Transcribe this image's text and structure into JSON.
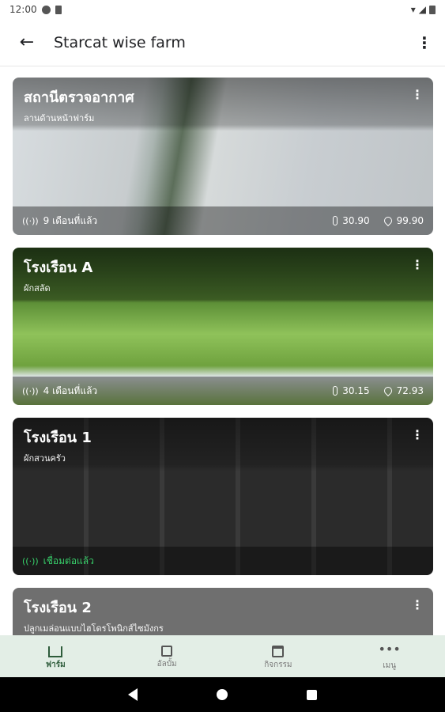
{
  "status_bar": {
    "time": "12:00"
  },
  "app_bar": {
    "title": "Starcat wise farm",
    "back_icon": "arrow-left-icon",
    "more_icon": "more-vert-icon"
  },
  "cards": [
    {
      "title": "สถานีตรวจอากาศ",
      "subtitle": "ลานด้านหน้าฟาร์ม",
      "last_seen": "9 เดือนที่แล้ว",
      "temperature": "30.90",
      "humidity": "99.90"
    },
    {
      "title": "โรงเรือน A",
      "subtitle": "ผักสลัด",
      "last_seen": "4 เดือนที่แล้ว",
      "temperature": "30.15",
      "humidity": "72.93"
    },
    {
      "title": "โรงเรือน 1",
      "subtitle": "ผักสวนครัว",
      "last_seen": "เชื่อมต่อแล้ว"
    },
    {
      "title": "โรงเรือน 2",
      "subtitle": "ปลูกเมล่อนแบบไฮโดรโพนิกส์ไซมังกร"
    }
  ],
  "bottom_nav": [
    {
      "label": "ฟาร์ม",
      "icon": "home-icon",
      "active": true
    },
    {
      "label": "อัลบั้ม",
      "icon": "gallery-icon",
      "active": false
    },
    {
      "label": "กิจกรรม",
      "icon": "calendar-icon",
      "active": false
    },
    {
      "label": "เมนู",
      "icon": "more-horiz-icon",
      "active": false
    }
  ],
  "colors": {
    "accent": "#2e5c3b",
    "nav_bg": "#e3eee6",
    "online": "#38d16b"
  }
}
